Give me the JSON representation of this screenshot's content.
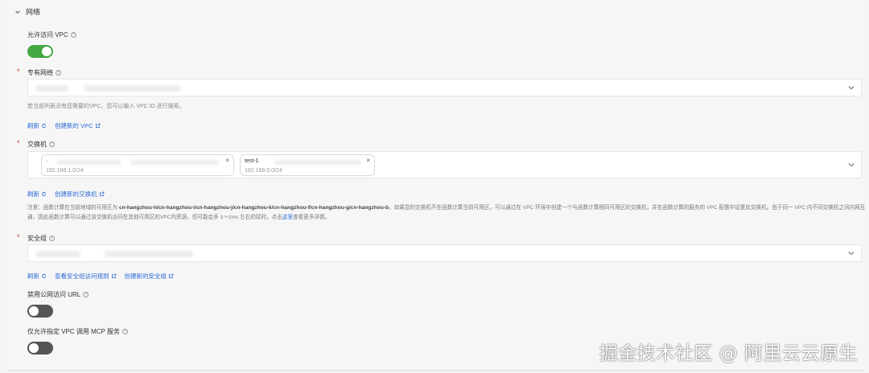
{
  "section": {
    "title": "网络"
  },
  "allow_vpc": {
    "label": "允许访问 VPC",
    "enabled": true
  },
  "vpc": {
    "label": "专有网络",
    "required_mark": "*",
    "hint": "若当前列表没有您需要的VPC，您可以输入 VPC ID 进行搜索。",
    "refresh_label": "刷新",
    "create_label": "创建新的 VPC"
  },
  "vswitch": {
    "label": "交换机",
    "required_mark": "*",
    "tags": [
      {
        "name": "·",
        "cidr": "192.168.1.0/24",
        "close": "×"
      },
      {
        "name": "test-1",
        "cidr": "192.168.0.0/24",
        "close": "×"
      }
    ],
    "refresh_label": "刷新",
    "create_label": "创建新的交换机",
    "note_prefix": "注意：函数计算在当前地域的可用区为 ",
    "note_zones": "cn-hangzhou-h/cn-hangzhou-i/cn-hangzhou-j/cn-hangzhou-k/cn-hangzhou-f/cn-hangzhou-g/cn-hangzhou-b",
    "note_mid": "。如果您的交换机不在函数计算当前可用区，可以通过在 VPC 环境中创建一个与函数计算相同可用区的交换机，并在函数计算的服务的 VPC 配置中设置此交换机。由于同一 VPC 内不同交换机之间内网互通，因此函数计算可以通过该交换机访问在其他可用区的VPC内资源，但可能会多 1～2ms 左右的延时。点击",
    "note_link": "这里",
    "note_suffix": "查看更多详情。"
  },
  "security_group": {
    "label": "安全组",
    "required_mark": "*",
    "refresh_label": "刷新",
    "view_rules_label": "查看安全组访问规则",
    "create_label": "创建新的安全组"
  },
  "disable_public_url": {
    "label": "禁用公网访问 URL",
    "enabled": false
  },
  "vpc_only_mcp": {
    "label": "仅允许指定 VPC 调用 MCP 服务",
    "enabled": false
  },
  "watermark": "掘金技术社区 @ 阿里云云原生",
  "icons": {
    "section_toggle": "chevron-down-icon",
    "help": "help-circle-icon",
    "dropdown": "chevron-down-icon",
    "refresh": "refresh-icon",
    "external": "external-link-icon",
    "close": "close-icon"
  },
  "colors": {
    "toggle_on": "#42a742",
    "toggle_off": "#555555",
    "link": "#2a6ad6",
    "required": "#d93026"
  }
}
